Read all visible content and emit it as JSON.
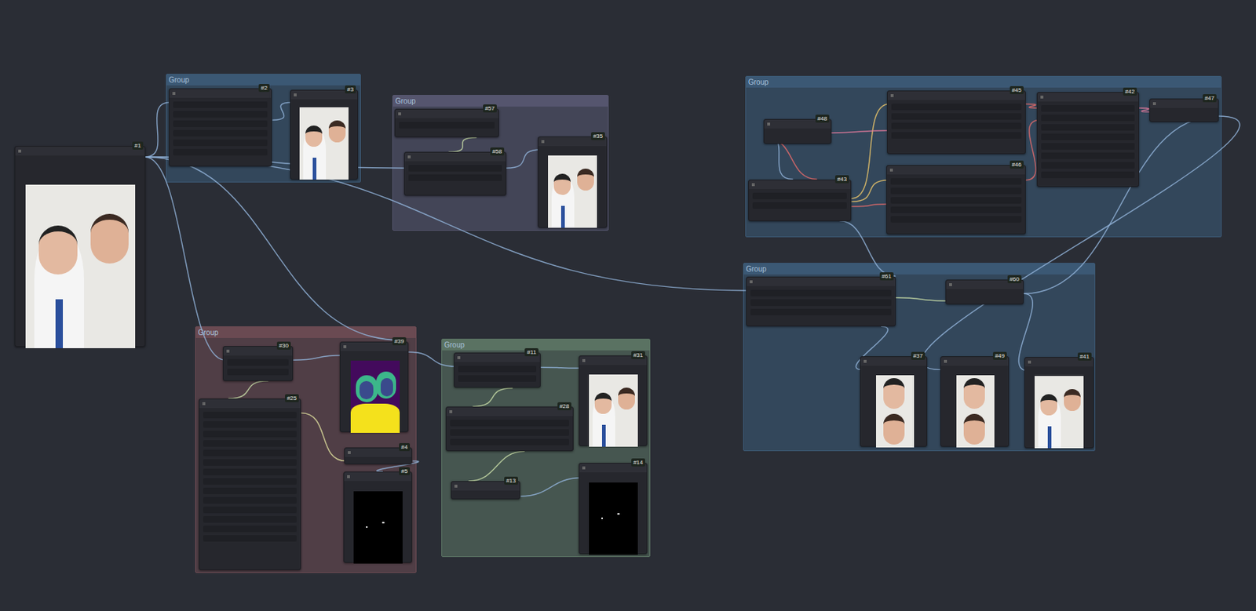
{
  "groups": [
    {
      "title": "Group",
      "color": "#3b5874"
    },
    {
      "title": "Group",
      "color": "#55556e"
    },
    {
      "title": "Group",
      "color": "#3b5874"
    },
    {
      "title": "Group",
      "color": "#3b5874"
    },
    {
      "title": "Group",
      "color": "#6a4a52"
    },
    {
      "title": "Group",
      "color": "#5a7262"
    }
  ],
  "nodes": [
    {
      "id": "#1",
      "kind": "photo"
    },
    {
      "id": "#2",
      "kind": "plain"
    },
    {
      "id": "#3",
      "kind": "photo"
    },
    {
      "id": "#57",
      "kind": "plain"
    },
    {
      "id": "#58",
      "kind": "plain"
    },
    {
      "id": "#35",
      "kind": "photo"
    },
    {
      "id": "#48",
      "kind": "plain"
    },
    {
      "id": "#45",
      "kind": "plain"
    },
    {
      "id": "#42",
      "kind": "plain"
    },
    {
      "id": "#47",
      "kind": "plain"
    },
    {
      "id": "#43",
      "kind": "plain"
    },
    {
      "id": "#46",
      "kind": "plain"
    },
    {
      "id": "#61",
      "kind": "plain"
    },
    {
      "id": "#60",
      "kind": "plain"
    },
    {
      "id": "#37",
      "kind": "faces"
    },
    {
      "id": "#49",
      "kind": "faces"
    },
    {
      "id": "#41",
      "kind": "photo"
    },
    {
      "id": "#30",
      "kind": "plain"
    },
    {
      "id": "#25",
      "kind": "plain"
    },
    {
      "id": "#39",
      "kind": "segmentation"
    },
    {
      "id": "#4",
      "kind": "plain"
    },
    {
      "id": "#5",
      "kind": "mask"
    },
    {
      "id": "#11",
      "kind": "plain"
    },
    {
      "id": "#31",
      "kind": "photo"
    },
    {
      "id": "#28",
      "kind": "plain"
    },
    {
      "id": "#13",
      "kind": "plain"
    },
    {
      "id": "#14",
      "kind": "mask"
    }
  ]
}
